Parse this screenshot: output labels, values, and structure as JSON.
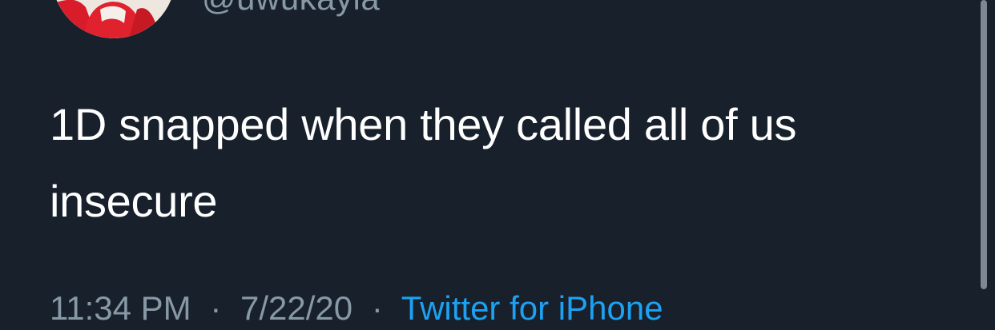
{
  "tweet": {
    "author_handle": "@uwukayla",
    "text_lines": [
      "1D snapped when they called all of us",
      "insecure"
    ],
    "time": "11:34 PM",
    "separator": "·",
    "date": "7/22/20",
    "source": "Twitter for iPhone"
  },
  "colors": {
    "background": "#17202b",
    "text": "#ffffff",
    "muted": "#8899a6",
    "link": "#1da1f2"
  },
  "icons": {
    "avatar": "profile-photo"
  }
}
